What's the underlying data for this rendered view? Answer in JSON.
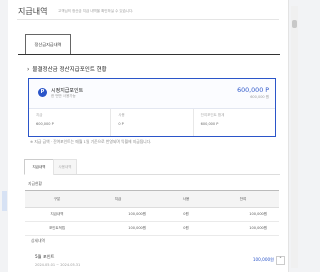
{
  "page": {
    "title": "지급내역",
    "description": "고객님의 정산금 지급 내역을 확인하실 수 있습니다."
  },
  "tabs": [
    {
      "label": "정산금지급내역"
    }
  ],
  "section": {
    "title": "물결정산금 정산지급포인트 현황"
  },
  "point_card": {
    "icon": "P",
    "name": "시정지급포인트",
    "sub": "한 번만 사용가능",
    "amount": "600,000 P",
    "amount_sub": "600,000 원",
    "cells": [
      {
        "label": "지급",
        "value": "600,000 P"
      },
      {
        "label": "사용",
        "value": "0 P"
      },
      {
        "label": "잔여포인트 합계",
        "value": "600,000 P"
      }
    ]
  },
  "notice": "※ 지급 금액 · 잔여포인트는 매월 1일 기준으로 반영되며 익월에 지급됩니다.",
  "subtabs": [
    {
      "label": "지급내역"
    },
    {
      "label": "사용내역"
    }
  ],
  "summary": {
    "heading": "지급현황",
    "headers": [
      "구분",
      "지급",
      "사용",
      "잔여"
    ],
    "rows": [
      [
        "지급내역",
        "100,000원",
        "0원",
        "100,000원"
      ],
      [
        "포인트적립",
        "100,000원",
        "0원",
        "100,000원"
      ]
    ]
  },
  "details": {
    "heading": "상세내역",
    "item_name": "5월 포인트",
    "item_period": "2024.05.01 ~ 2024.05.31",
    "item_amount": "100,000원"
  },
  "icons": {
    "section": "chevron-right-icon",
    "point": "point-coin-icon",
    "expand": "chevron-up-icon"
  },
  "colors": {
    "accent": "#2b55c9",
    "border": "#dddddd"
  }
}
